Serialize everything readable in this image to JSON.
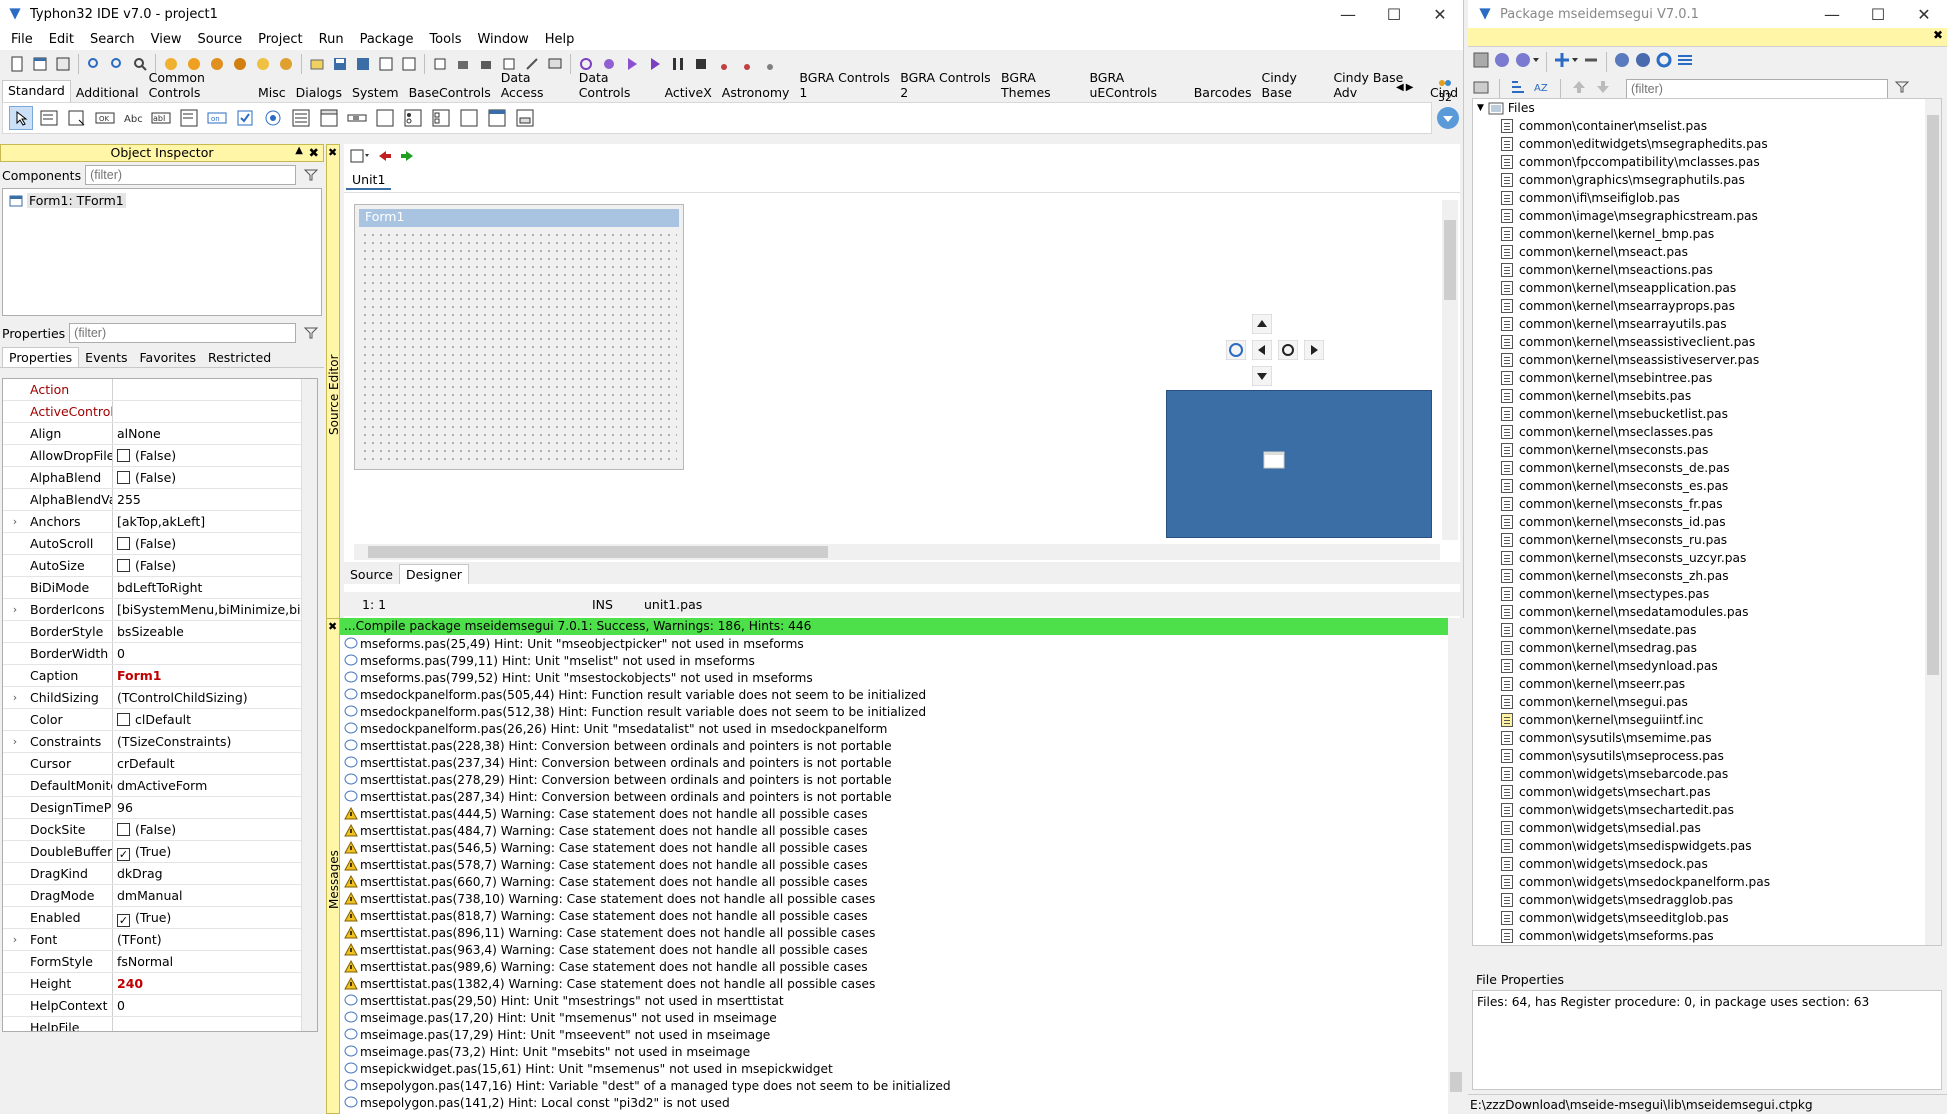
{
  "main": {
    "title": "Typhon32 IDE v7.0 - project1",
    "menu": [
      "File",
      "Edit",
      "Search",
      "View",
      "Source",
      "Project",
      "Run",
      "Package",
      "Tools",
      "Window",
      "Help"
    ],
    "palette_tabs": [
      "Standard",
      "Additional",
      "Common Controls",
      "Misc",
      "Dialogs",
      "System",
      "BaseControls",
      "Data Access",
      "Data Controls",
      "ActiveX",
      "Astronomy",
      "BGRA Controls 1",
      "BGRA Controls 2",
      "BGRA Themes",
      "BGRA uEControls",
      "Barcodes",
      "Cindy Base",
      "Cindy Base Adv",
      "Cind"
    ],
    "palette_count": "32"
  },
  "inspector": {
    "title": "Object Inspector",
    "components_label": "Components",
    "filter_placeholder": "(filter)",
    "tree_item": "Form1: TForm1",
    "properties_label": "Properties",
    "tabs": [
      "Properties",
      "Events",
      "Favorites",
      "Restricted"
    ],
    "rows": [
      {
        "name": "Action",
        "value": "",
        "red": true
      },
      {
        "name": "ActiveControl",
        "value": "",
        "red": true
      },
      {
        "name": "Align",
        "value": "alNone"
      },
      {
        "name": "AllowDropFiles",
        "value": "(False)",
        "check": "off"
      },
      {
        "name": "AlphaBlend",
        "value": "(False)",
        "check": "off"
      },
      {
        "name": "AlphaBlendValu",
        "value": "255"
      },
      {
        "name": "Anchors",
        "value": "[akTop,akLeft]",
        "exp": true
      },
      {
        "name": "AutoScroll",
        "value": "(False)",
        "check": "off"
      },
      {
        "name": "AutoSize",
        "value": "(False)",
        "check": "off"
      },
      {
        "name": "BiDiMode",
        "value": "bdLeftToRight"
      },
      {
        "name": "BorderIcons",
        "value": "[biSystemMenu,biMinimize,biMax",
        "exp": true
      },
      {
        "name": "BorderStyle",
        "value": "bsSizeable"
      },
      {
        "name": "BorderWidth",
        "value": "0"
      },
      {
        "name": "Caption",
        "value": "Form1",
        "bold": true
      },
      {
        "name": "ChildSizing",
        "value": "(TControlChildSizing)",
        "exp": true
      },
      {
        "name": "Color",
        "value": "clDefault",
        "swatch": true
      },
      {
        "name": "Constraints",
        "value": "(TSizeConstraints)",
        "exp": true
      },
      {
        "name": "Cursor",
        "value": "crDefault"
      },
      {
        "name": "DefaultMonitor",
        "value": "dmActiveForm"
      },
      {
        "name": "DesignTimePPI",
        "value": "96"
      },
      {
        "name": "DockSite",
        "value": "(False)",
        "check": "off"
      },
      {
        "name": "DoubleBuffered",
        "value": "(True)",
        "check": "on"
      },
      {
        "name": "DragKind",
        "value": "dkDrag"
      },
      {
        "name": "DragMode",
        "value": "dmManual"
      },
      {
        "name": "Enabled",
        "value": "(True)",
        "check": "on"
      },
      {
        "name": "Font",
        "value": "(TFont)",
        "exp": true
      },
      {
        "name": "FormStyle",
        "value": "fsNormal"
      },
      {
        "name": "Height",
        "value": "240",
        "bold": true
      },
      {
        "name": "HelpContext",
        "value": "0"
      },
      {
        "name": "HelpFile",
        "value": ""
      }
    ]
  },
  "editor": {
    "side_label": "Source Editor",
    "tab": "Unit1",
    "form_caption": "Form1",
    "bottom_tabs": [
      "Source",
      "Designer"
    ],
    "status_pos": "1:  1",
    "status_mode": "INS",
    "status_file": "unit1.pas"
  },
  "messages": {
    "side_label": "Messages",
    "header": "...Compile package mseidemsegui 7.0.1: Success, Warnings: 186, Hints: 446",
    "lines": [
      {
        "t": "h",
        "text": "mseforms.pas(25,49) Hint: Unit \"mseobjectpicker\" not used in mseforms"
      },
      {
        "t": "h",
        "text": "mseforms.pas(799,11) Hint: Unit \"mselist\" not used in mseforms"
      },
      {
        "t": "h",
        "text": "mseforms.pas(799,52) Hint: Unit \"msestockobjects\" not used in mseforms"
      },
      {
        "t": "h",
        "text": "msedockpanelform.pas(505,44) Hint: Function result variable does not seem to be initialized"
      },
      {
        "t": "h",
        "text": "msedockpanelform.pas(512,38) Hint: Function result variable does not seem to be initialized"
      },
      {
        "t": "h",
        "text": "msedockpanelform.pas(26,26) Hint: Unit \"msedatalist\" not used in msedockpanelform"
      },
      {
        "t": "h",
        "text": "mserttistat.pas(228,38) Hint: Conversion between ordinals and pointers is not portable"
      },
      {
        "t": "h",
        "text": "mserttistat.pas(237,34) Hint: Conversion between ordinals and pointers is not portable"
      },
      {
        "t": "h",
        "text": "mserttistat.pas(278,29) Hint: Conversion between ordinals and pointers is not portable"
      },
      {
        "t": "h",
        "text": "mserttistat.pas(287,34) Hint: Conversion between ordinals and pointers is not portable"
      },
      {
        "t": "w",
        "text": "mserttistat.pas(444,5) Warning: Case statement does not handle all possible cases"
      },
      {
        "t": "w",
        "text": "mserttistat.pas(484,7) Warning: Case statement does not handle all possible cases"
      },
      {
        "t": "w",
        "text": "mserttistat.pas(546,5) Warning: Case statement does not handle all possible cases"
      },
      {
        "t": "w",
        "text": "mserttistat.pas(578,7) Warning: Case statement does not handle all possible cases"
      },
      {
        "t": "w",
        "text": "mserttistat.pas(660,7) Warning: Case statement does not handle all possible cases"
      },
      {
        "t": "w",
        "text": "mserttistat.pas(738,10) Warning: Case statement does not handle all possible cases"
      },
      {
        "t": "w",
        "text": "mserttistat.pas(818,7) Warning: Case statement does not handle all possible cases"
      },
      {
        "t": "w",
        "text": "mserttistat.pas(896,11) Warning: Case statement does not handle all possible cases"
      },
      {
        "t": "w",
        "text": "mserttistat.pas(963,4) Warning: Case statement does not handle all possible cases"
      },
      {
        "t": "w",
        "text": "mserttistat.pas(989,6) Warning: Case statement does not handle all possible cases"
      },
      {
        "t": "w",
        "text": "mserttistat.pas(1382,4) Warning: Case statement does not handle all possible cases"
      },
      {
        "t": "h",
        "text": "mserttistat.pas(29,50) Hint: Unit \"msestrings\" not used in mserttistat"
      },
      {
        "t": "h",
        "text": "mseimage.pas(17,20) Hint: Unit \"msemenus\" not used in mseimage"
      },
      {
        "t": "h",
        "text": "mseimage.pas(17,29) Hint: Unit \"mseevent\" not used in mseimage"
      },
      {
        "t": "h",
        "text": "mseimage.pas(73,2) Hint: Unit \"msebits\" not used in mseimage"
      },
      {
        "t": "h",
        "text": "msepickwidget.pas(15,61) Hint: Unit \"msemenus\" not used in msepickwidget"
      },
      {
        "t": "h",
        "text": "msepolygon.pas(147,16) Hint: Variable \"dest\" of a managed type does not seem to be initialized"
      },
      {
        "t": "h",
        "text": "msepolygon.pas(141,2) Hint: Local const \"pi3d2\" is not used"
      }
    ]
  },
  "package": {
    "title": "Package mseidemsegui V7.0.1",
    "filter_placeholder": "(filter)",
    "root": "Files",
    "files": [
      "common\\container\\mselist.pas",
      "common\\editwidgets\\msegraphedits.pas",
      "common\\fpccompatibility\\mclasses.pas",
      "common\\graphics\\msegraphutils.pas",
      "common\\ifi\\mseifiglob.pas",
      "common\\image\\msegraphicstream.pas",
      "common\\kernel\\kernel_bmp.pas",
      "common\\kernel\\mseact.pas",
      "common\\kernel\\mseactions.pas",
      "common\\kernel\\mseapplication.pas",
      "common\\kernel\\msearrayprops.pas",
      "common\\kernel\\msearrayutils.pas",
      "common\\kernel\\mseassistiveclient.pas",
      "common\\kernel\\mseassistiveserver.pas",
      "common\\kernel\\msebintree.pas",
      "common\\kernel\\msebits.pas",
      "common\\kernel\\msebucketlist.pas",
      "common\\kernel\\mseclasses.pas",
      "common\\kernel\\mseconsts.pas",
      "common\\kernel\\mseconsts_de.pas",
      "common\\kernel\\mseconsts_es.pas",
      "common\\kernel\\mseconsts_fr.pas",
      "common\\kernel\\mseconsts_id.pas",
      "common\\kernel\\mseconsts_ru.pas",
      "common\\kernel\\mseconsts_uzcyr.pas",
      "common\\kernel\\mseconsts_zh.pas",
      "common\\kernel\\msectypes.pas",
      "common\\kernel\\msedatamodules.pas",
      "common\\kernel\\msedate.pas",
      "common\\kernel\\msedrag.pas",
      "common\\kernel\\msedynload.pas",
      "common\\kernel\\mseerr.pas",
      "common\\kernel\\msegui.pas",
      "common\\kernel\\mseguiintf.inc",
      "common\\sysutils\\msemime.pas",
      "common\\sysutils\\mseprocess.pas",
      "common\\widgets\\msebarcode.pas",
      "common\\widgets\\msechart.pas",
      "common\\widgets\\msechartedit.pas",
      "common\\widgets\\msedial.pas",
      "common\\widgets\\msedispwidgets.pas",
      "common\\widgets\\msedock.pas",
      "common\\widgets\\msedockpanelform.pas",
      "common\\widgets\\msedragglob.pas",
      "common\\widgets\\mseeditglob.pas",
      "common\\widgets\\mseforms.pas"
    ],
    "props_label": "File Properties",
    "props_text": "Files: 64, has Register procedure: 0, in package uses section: 63",
    "status_path": "E:\\zzzDownload\\mseide-msegui\\lib\\mseidemsegui.ctpkg"
  }
}
